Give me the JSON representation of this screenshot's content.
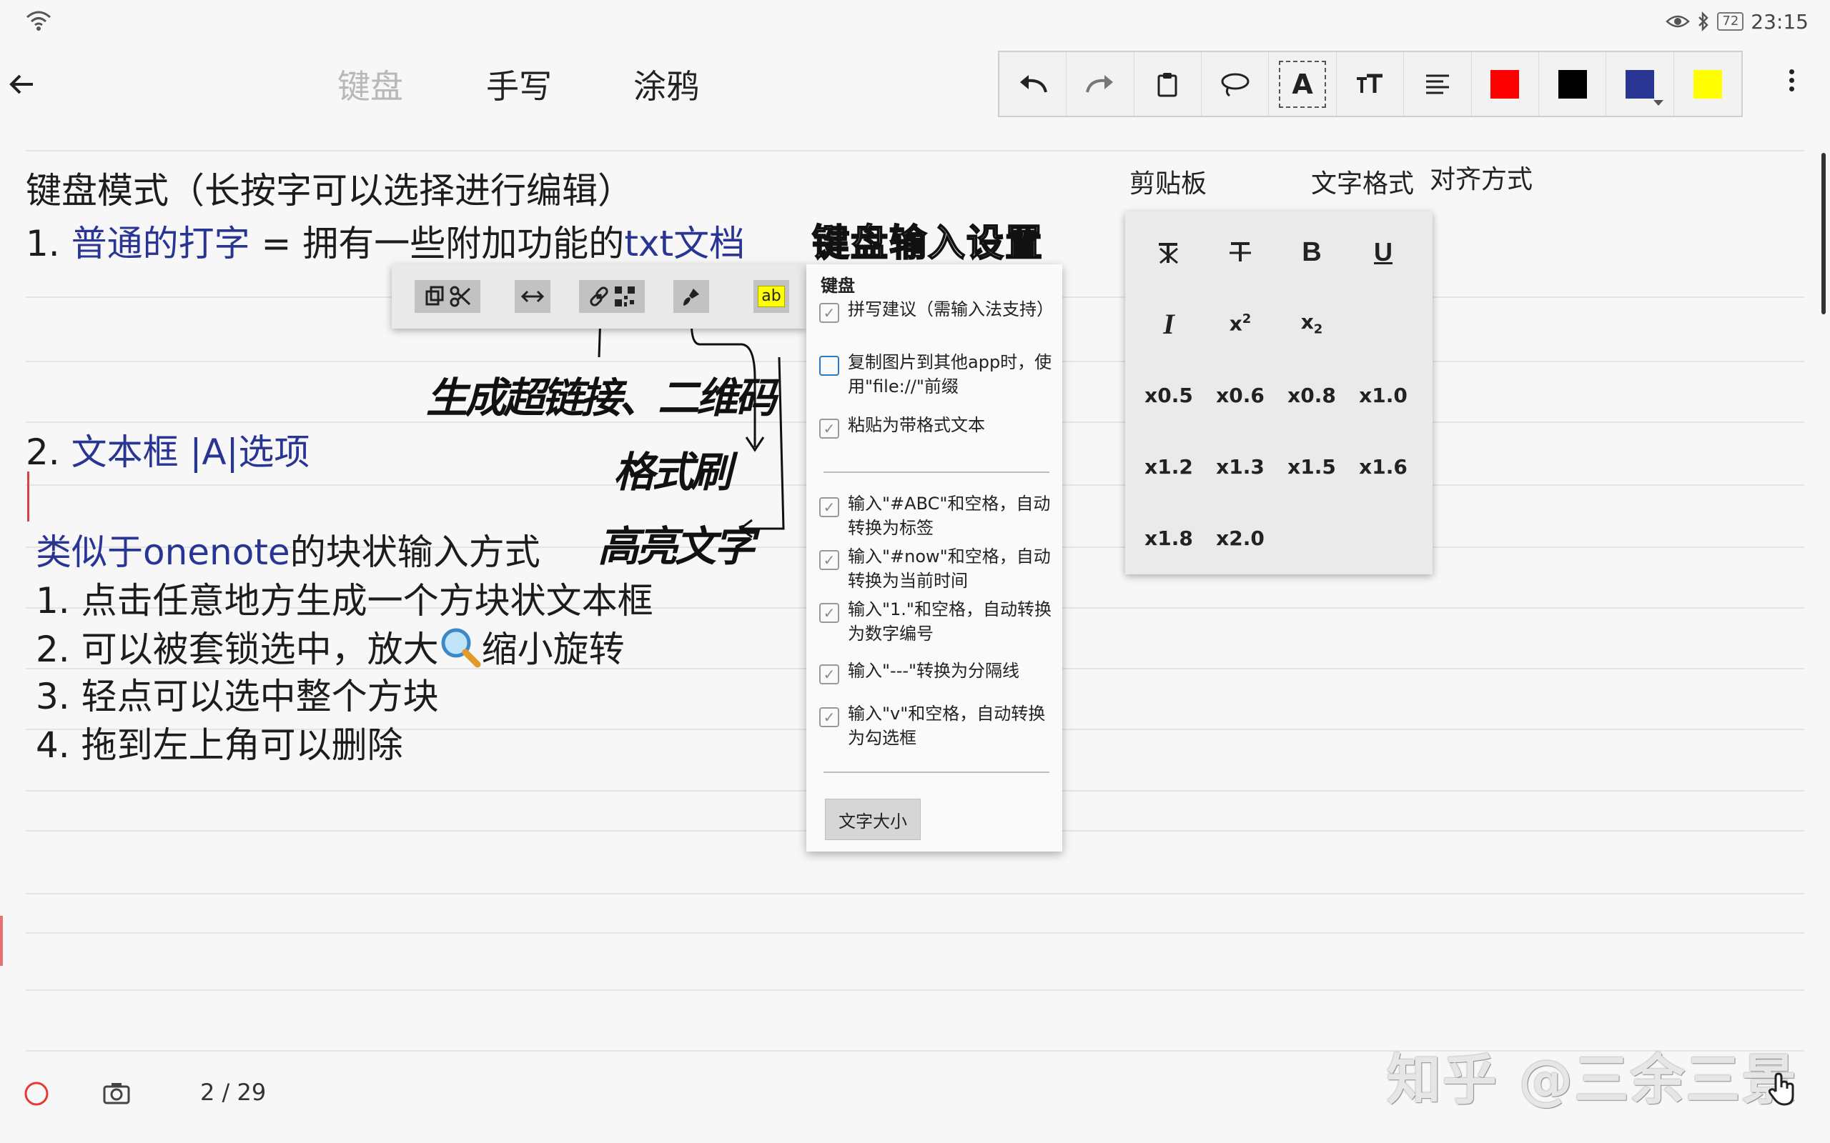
{
  "status_bar": {
    "battery": "72",
    "time": "23:15"
  },
  "header": {
    "tabs": [
      {
        "label": "键盘"
      },
      {
        "label": "手写"
      },
      {
        "label": "涂鸦"
      }
    ]
  },
  "colors": {
    "red": "#ff0000",
    "black": "#000000",
    "blue": "#283593",
    "yellow": "#ffff00",
    "inactive_tab": "#b8b8b8"
  },
  "note": {
    "heading": "键盘模式（长按字可以选择进行编辑）",
    "line1_num": "1.",
    "line1_link": "普通的打字",
    "line1_mid": " = 拥有一些附加功能的",
    "line1_link2": "txt文档",
    "line1_ann": "键盘输入设置",
    "line2_num": "2.",
    "line2_text": "文本框 |A|选项",
    "block_title_link": "类似于onenote",
    "block_title_rest": "的块状输入方式",
    "list": [
      {
        "num": "1.",
        "text": "点击任意地方生成一个方块状文本框"
      },
      {
        "num": "2.",
        "text_a": "可以被套锁选中，放大",
        "text_b": "缩小旋转"
      },
      {
        "num": "3.",
        "text": "轻点可以选中整个方块"
      },
      {
        "num": "4.",
        "text": "拖到左上角可以删除"
      }
    ]
  },
  "handwriting": {
    "note1": "生成超链接、二维码",
    "note2": "格式刷",
    "note3": "高亮文字"
  },
  "context_menu": {
    "highlight_label": "ab"
  },
  "keyboard_panel": {
    "title": "键盘",
    "items": [
      {
        "label": "拼写建议（需输入法支持）"
      },
      {
        "label": "复制图片到其他app时，使用\"file://\"前缀"
      },
      {
        "label": "粘贴为带格式文本"
      },
      {
        "label": "输入\"#ABC\"和空格，自动转换为标签"
      },
      {
        "label": "输入\"#now\"和空格，自动转换为当前时间"
      },
      {
        "label": "输入\"1.\"和空格，自动转换为数字编号"
      },
      {
        "label": "输入\"---\"转换为分隔线"
      },
      {
        "label": "输入\"v\"和空格，自动转换为勾选框"
      }
    ],
    "text_size_button": "文字大小"
  },
  "format_labels": {
    "clipboard": "剪贴板",
    "text_format": "文字格式",
    "align": "对齐方式"
  },
  "format_panel": {
    "sizes": [
      "x0.5",
      "x0.6",
      "x0.8",
      "x1.0",
      "x1.2",
      "x1.3",
      "x1.5",
      "x1.6",
      "x1.8",
      "x2.0"
    ]
  },
  "footer": {
    "page_indicator": "2 / 29"
  },
  "watermark": "知乎 @三余三景"
}
